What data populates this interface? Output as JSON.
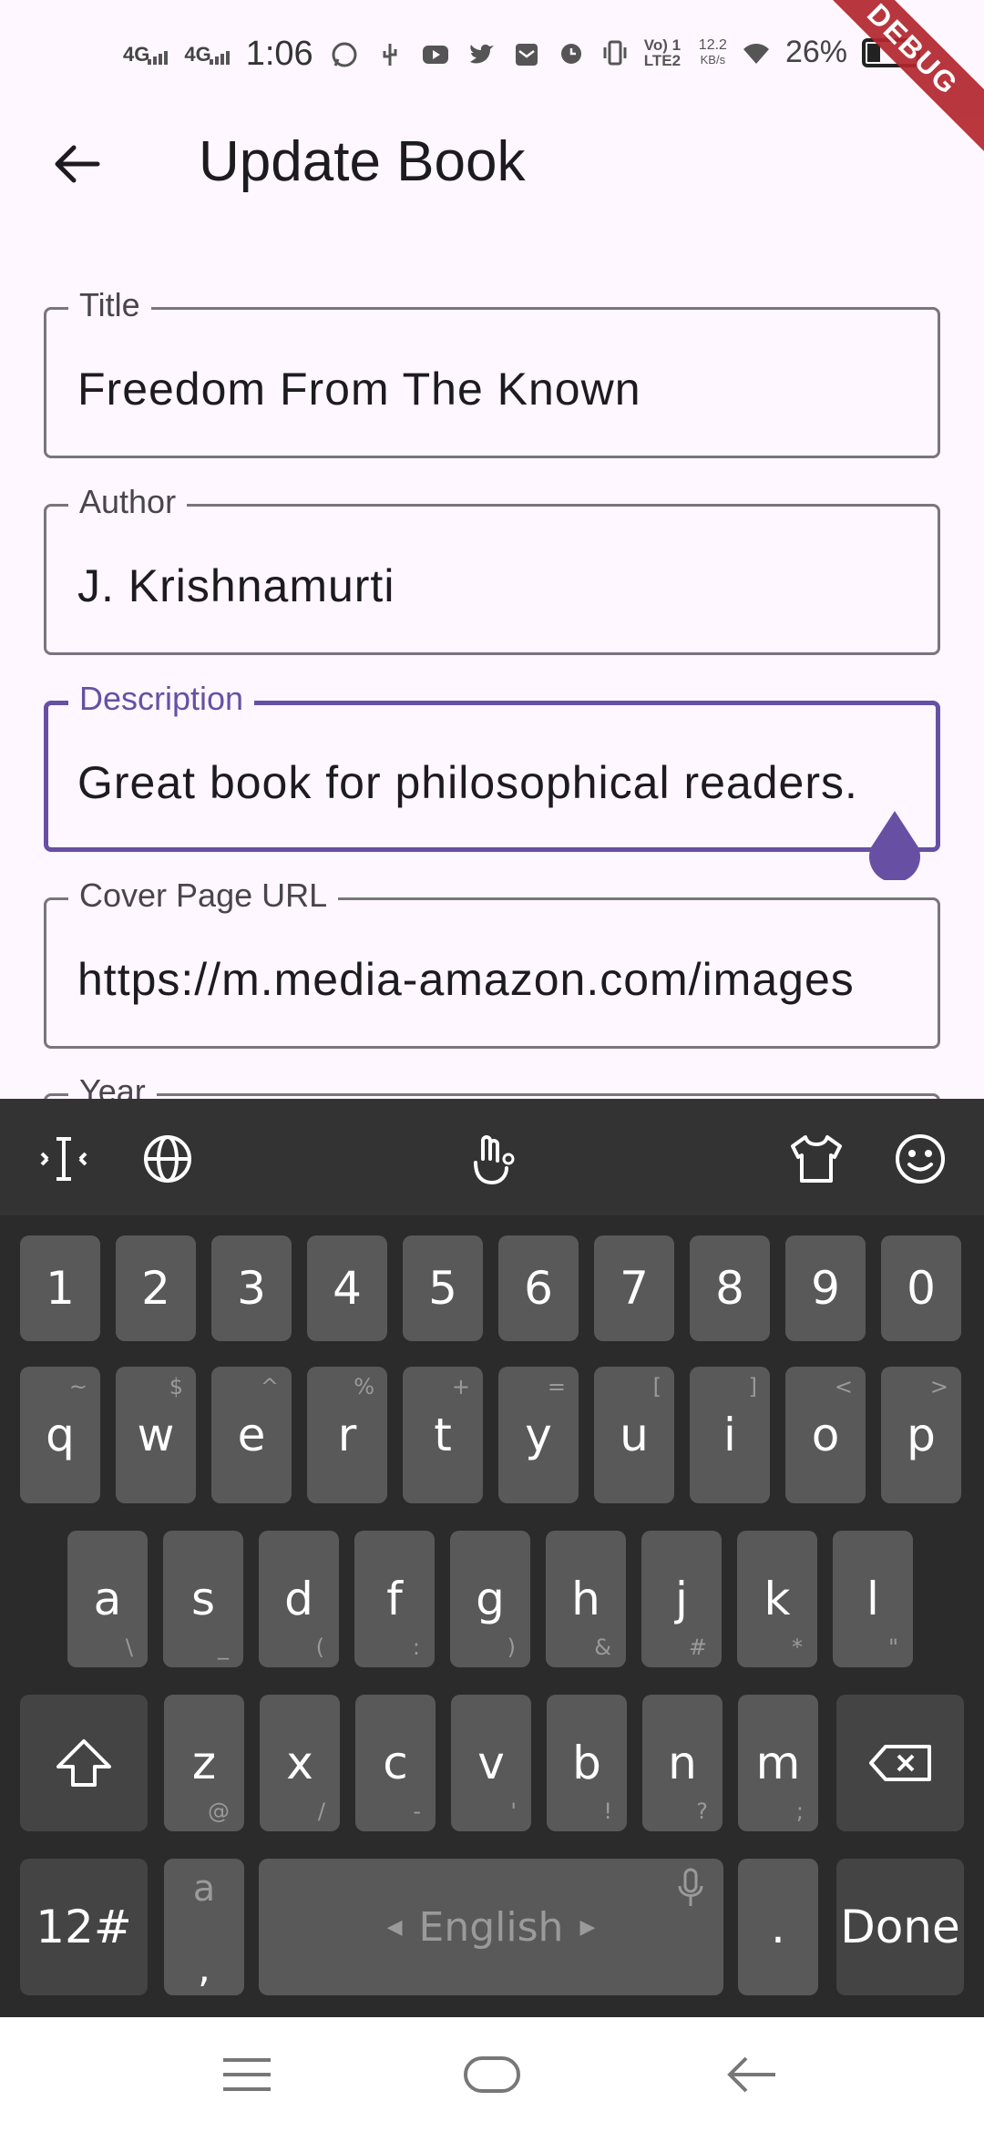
{
  "status_bar": {
    "network_1": "4G",
    "network_2": "4G",
    "time": "1:06",
    "lte": "Vo) 1 LTE2",
    "speed_value": "12.2",
    "speed_unit": "KB/s",
    "battery": "26%",
    "debug_badge": "DEBUG"
  },
  "app_bar": {
    "title": "Update Book"
  },
  "form": {
    "title": {
      "label": "Title",
      "value": "Freedom From The Known"
    },
    "author": {
      "label": "Author",
      "value": "J. Krishnamurti"
    },
    "description": {
      "label": "Description",
      "value": "Great book for philosophical readers."
    },
    "cover_url": {
      "label": "Cover Page URL",
      "value": "https://m.media-amazon.com/images"
    },
    "year": {
      "label": "Year"
    }
  },
  "keyboard": {
    "number_row": [
      "1",
      "2",
      "3",
      "4",
      "5",
      "6",
      "7",
      "8",
      "9",
      "0"
    ],
    "row1": [
      {
        "k": "q",
        "s": "~"
      },
      {
        "k": "w",
        "s": "$"
      },
      {
        "k": "e",
        "s": "^"
      },
      {
        "k": "r",
        "s": "%"
      },
      {
        "k": "t",
        "s": "+"
      },
      {
        "k": "y",
        "s": "="
      },
      {
        "k": "u",
        "s": "["
      },
      {
        "k": "i",
        "s": "]"
      },
      {
        "k": "o",
        "s": "<"
      },
      {
        "k": "p",
        "s": ">"
      }
    ],
    "row2": [
      {
        "k": "a",
        "s": "\\"
      },
      {
        "k": "s",
        "s": "_"
      },
      {
        "k": "d",
        "s": "("
      },
      {
        "k": "f",
        "s": ":"
      },
      {
        "k": "g",
        "s": ")"
      },
      {
        "k": "h",
        "s": "&"
      },
      {
        "k": "j",
        "s": "#"
      },
      {
        "k": "k",
        "s": "*"
      },
      {
        "k": "l",
        "s": "\""
      }
    ],
    "row3": [
      {
        "k": "z",
        "s": "@"
      },
      {
        "k": "x",
        "s": "/"
      },
      {
        "k": "c",
        "s": "-"
      },
      {
        "k": "v",
        "s": "'"
      },
      {
        "k": "b",
        "s": "!"
      },
      {
        "k": "n",
        "s": "?"
      },
      {
        "k": "m",
        "s": ";"
      }
    ],
    "symbols_label": "12#",
    "comma_top": "a",
    "comma": ",",
    "space_label": "English",
    "period": ".",
    "done_label": "Done",
    "accent_color": "#6750a4"
  },
  "icons": {
    "status_left": [
      "whatsapp-icon",
      "usb-icon",
      "youtube-icon",
      "twitter-icon",
      "email-icon"
    ],
    "status_right": [
      "alarm-icon",
      "vibrate-icon",
      "wifi-icon",
      "battery-icon"
    ],
    "toolbar": [
      "cursor-icon",
      "globe-icon",
      "gesture-icon",
      "theme-icon",
      "emoji-icon"
    ],
    "nav": [
      "menu-icon",
      "home-icon",
      "back-icon"
    ]
  }
}
